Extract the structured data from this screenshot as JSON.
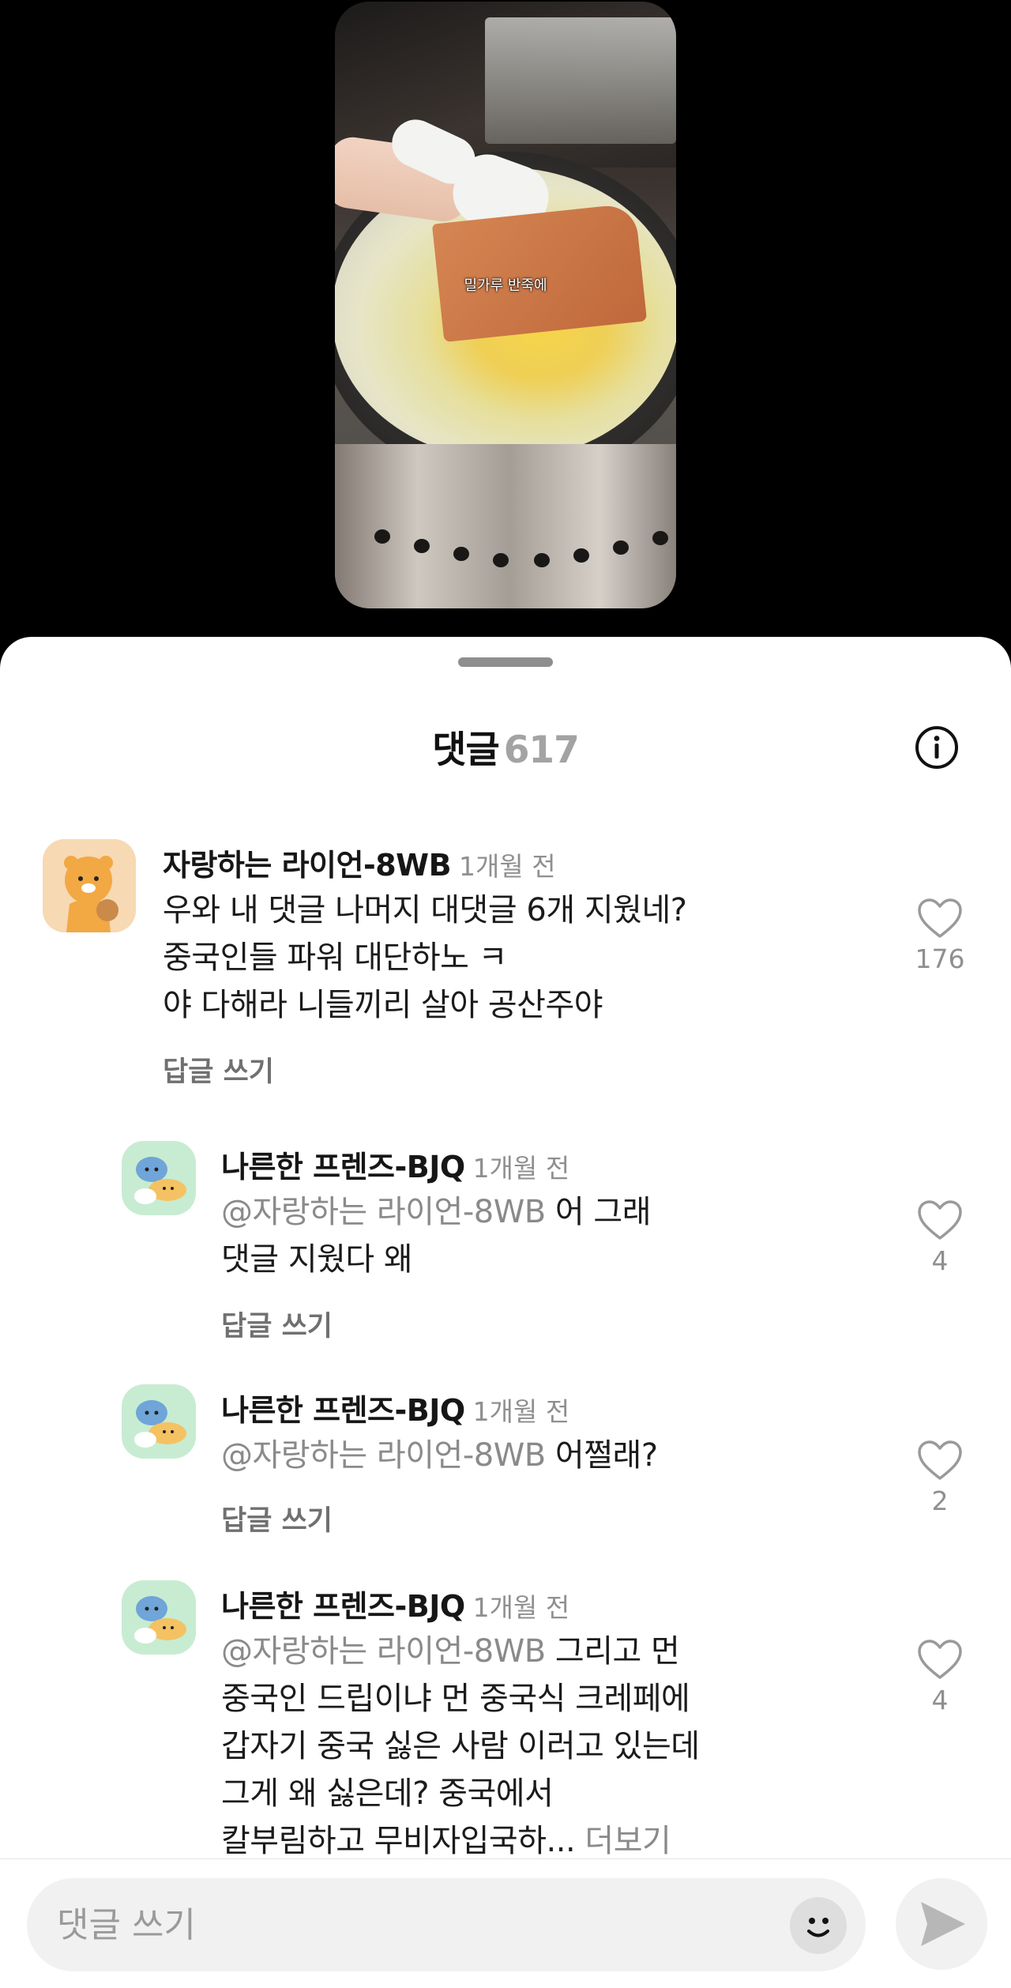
{
  "video": {
    "caption": "밀가루 반죽에"
  },
  "sheet": {
    "title": "댓글",
    "count": "617"
  },
  "comments": [
    {
      "author": "자랑하는 라이언-8WB",
      "time": "1개월 전",
      "avatar": "ryan-avatar-icon",
      "lines": [
        "우와 내 댓글 나머지 대댓글 6개 지웠네?",
        "중국인들 파워 대단하노 ㅋ",
        "야 다해라 니들끼리 살아 공산주야"
      ],
      "likes": "176",
      "reply": "답글 쓰기"
    },
    {
      "author": "나른한 프렌즈-BJQ",
      "time": "1개월 전",
      "avatar": "friends-avatar-icon",
      "mention": "@자랑하는 라이언-8WB",
      "lines": [
        " 어 그래",
        "댓글 지웠다 왜"
      ],
      "likes": "4",
      "reply": "답글 쓰기"
    },
    {
      "author": "나른한 프렌즈-BJQ",
      "time": "1개월 전",
      "avatar": "friends-avatar-icon",
      "mention": "@자랑하는 라이언-8WB",
      "lines": [
        " 어쩔래?"
      ],
      "likes": "2",
      "reply": "답글 쓰기"
    },
    {
      "author": "나른한 프렌즈-BJQ",
      "time": "1개월 전",
      "avatar": "friends-avatar-icon",
      "mention": "@자랑하는 라이언-8WB",
      "lines": [
        " 그리고 먼",
        "중국인 드립이냐 먼 중국식 크레페에",
        "갑자기 중국 싫은 사람 이러고 있는데",
        "그게 왜 싫은데? 중국에서",
        "칼부림하고 무비자입국하..."
      ],
      "more": "더보기",
      "likes": "4"
    }
  ],
  "input": {
    "placeholder": "댓글 쓰기"
  }
}
